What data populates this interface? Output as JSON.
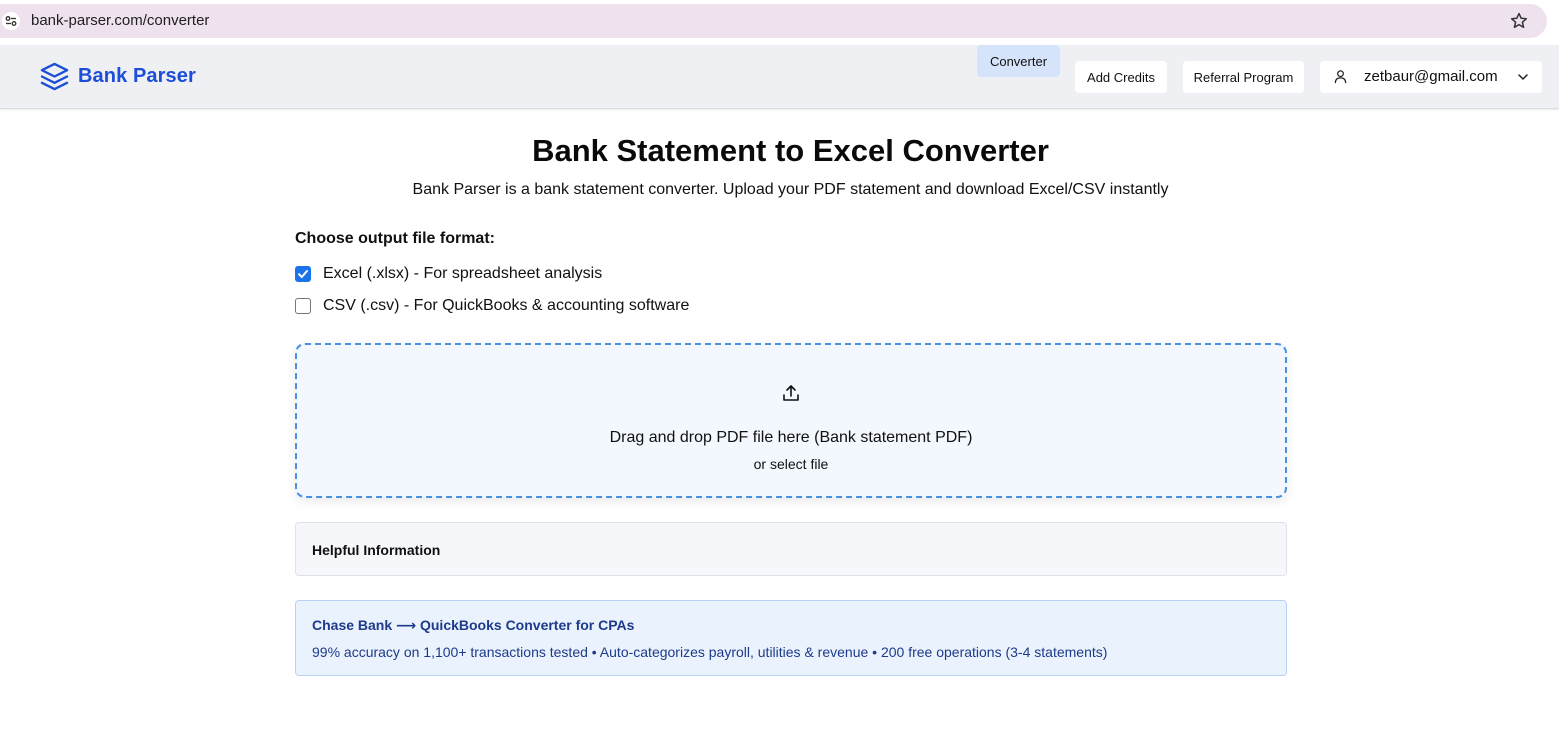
{
  "browser": {
    "url": "bank-parser.com/converter"
  },
  "header": {
    "brand_name": "Bank Parser",
    "nav": [
      {
        "label": "Converter",
        "active": true
      },
      {
        "label": "Add Credits",
        "active": false
      },
      {
        "label": "Referral Program",
        "active": false
      }
    ],
    "user_email": "zetbaur@gmail.com"
  },
  "main": {
    "title": "Bank Statement to Excel Converter",
    "subtitle": "Bank Parser is a bank statement converter. Upload your PDF statement and download Excel/CSV instantly",
    "format_heading": "Choose output file format:",
    "formats": [
      {
        "label": "Excel (.xlsx) - For spreadsheet analysis",
        "checked": true
      },
      {
        "label": "CSV (.csv) - For QuickBooks & accounting software",
        "checked": false
      }
    ],
    "dropzone": {
      "primary_text": "Drag and drop PDF file here (Bank statement PDF)",
      "secondary_text": "or select file"
    },
    "helpful_info_title": "Helpful Information",
    "promo": {
      "title": "Chase Bank ⟶ QuickBooks Converter for CPAs",
      "text": "99% accuracy on 1,100+ transactions tested • Auto-categorizes payroll, utilities & revenue • 200 free operations (3-4 statements)"
    }
  },
  "colors": {
    "brand": "#1d4ed8",
    "checkbox_checked": "#1a73e8",
    "dropzone_border": "#4a8fe0",
    "promo_text": "#1e3a8a"
  }
}
